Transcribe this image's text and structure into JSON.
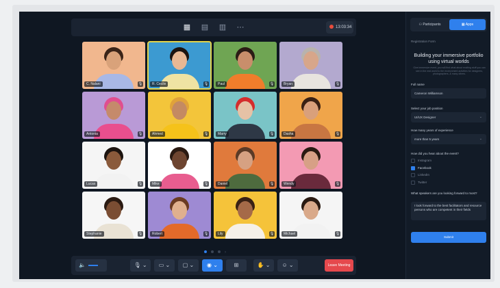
{
  "meeting": {
    "timer": "13:03:34",
    "view_icons": [
      "grid-view-icon",
      "sidebar-view-icon",
      "layout-view-icon",
      "more-view-icon"
    ]
  },
  "participants": [
    {
      "name": "C. Nalani",
      "skin": "#d9a27a",
      "hair": "#3b2418",
      "shirt": "#a8b8e6",
      "bg": "#f1b78e"
    },
    {
      "name": "R. Cecile",
      "skin": "#e8b894",
      "hair": "#1c1410",
      "shirt": "#efe3a3",
      "bg": "#3c9ad1"
    },
    {
      "name": "Paul",
      "skin": "#c98e6b",
      "hair": "#2b1c15",
      "shirt": "#f07d2b",
      "bg": "#6fa553"
    },
    {
      "name": "Bryan",
      "skin": "#d7a68a",
      "hair": "#b8b3ad",
      "shirt": "#e8e4df",
      "bg": "#b3a9cf"
    },
    {
      "name": "Antonia",
      "skin": "#c58a6b",
      "hair": "#e04e8f",
      "shirt": "#e94f8e",
      "bg": "#b99ad6"
    },
    {
      "name": "Ahmed",
      "skin": "#c48a62",
      "hair": "#e0a23a",
      "shirt": "#f5c21a",
      "bg": "#f3c53a"
    },
    {
      "name": "Marry",
      "skin": "#e6c2a6",
      "hair": "#d42d2d",
      "shirt": "#2e3846",
      "bg": "#7ac4c7"
    },
    {
      "name": "Dasha",
      "skin": "#d9a07b",
      "hair": "#3a2114",
      "shirt": "#c87642",
      "bg": "#f0a54a"
    },
    {
      "name": "Lucas",
      "skin": "#8a5a3b",
      "hair": "#1c1410",
      "shirt": "#f2f2f2",
      "bg": "#f5f5f5"
    },
    {
      "name": "Mike",
      "skin": "#6e4530",
      "hair": "#2a1a12",
      "shirt": "#e85d8f",
      "bg": "#ffffff"
    },
    {
      "name": "Daniel",
      "skin": "#d6a182",
      "hair": "#5b3a26",
      "shirt": "#4e6b3e",
      "bg": "#e07a3c"
    },
    {
      "name": "Wendy",
      "skin": "#d7a086",
      "hair": "#2a1a12",
      "shirt": "#6a2a3c",
      "bg": "#f39ab3"
    },
    {
      "name": "Stephanie",
      "skin": "#7a4d33",
      "hair": "#2a1a12",
      "shirt": "#e9e2d4",
      "bg": "#f6f6f6"
    },
    {
      "name": "Robert",
      "skin": "#e0b08e",
      "hair": "#6b3b22",
      "shirt": "#e36a2a",
      "bg": "#9e8ad3"
    },
    {
      "name": "Lily",
      "skin": "#a56a48",
      "hair": "#3a2114",
      "shirt": "#f5f0e8",
      "bg": "#f5c33a"
    },
    {
      "name": "Michael",
      "skin": "#d9a98a",
      "hair": "#2a1a12",
      "shirt": "#f2f2f2",
      "bg": "#f5f5f5"
    }
  ],
  "selected_index": 1,
  "pagination": {
    "pages": 3,
    "current": 1
  },
  "controls": {
    "volume_icon": "speaker-icon",
    "volume_level": 0.5,
    "leave_label": "Leave Meeting"
  },
  "panel": {
    "tabs": [
      {
        "label": "Participants",
        "active": false
      },
      {
        "label": "Apps",
        "active": true
      }
    ],
    "form_section": "Registration Form",
    "form_title": "Building your immersive portfolio using virtual worlds",
    "form_desc": "Give immersive event, you will find what about exciting stuff you can see in the real world to the environment activities for designers, photographers, & many others.",
    "full_name_label": "Full name",
    "full_name_value": "Cameron Williamson",
    "job_label": "Select your job position",
    "job_value": "UI/UX Designer",
    "years_label": "How many years of experience",
    "years_value": "more than 5 years",
    "heard_label": "How did you hear about the event?",
    "options": [
      {
        "label": "Instagram",
        "checked": false
      },
      {
        "label": "Facebook",
        "checked": true
      },
      {
        "label": "LinkedIn",
        "checked": false
      },
      {
        "label": "Twitter",
        "checked": false
      }
    ],
    "speakers_label": "What speakers are you looking forward to most?",
    "speakers_value": "I look forward to the best facilitators and resource persons who are competent in their fields",
    "submit_label": "Submit"
  }
}
